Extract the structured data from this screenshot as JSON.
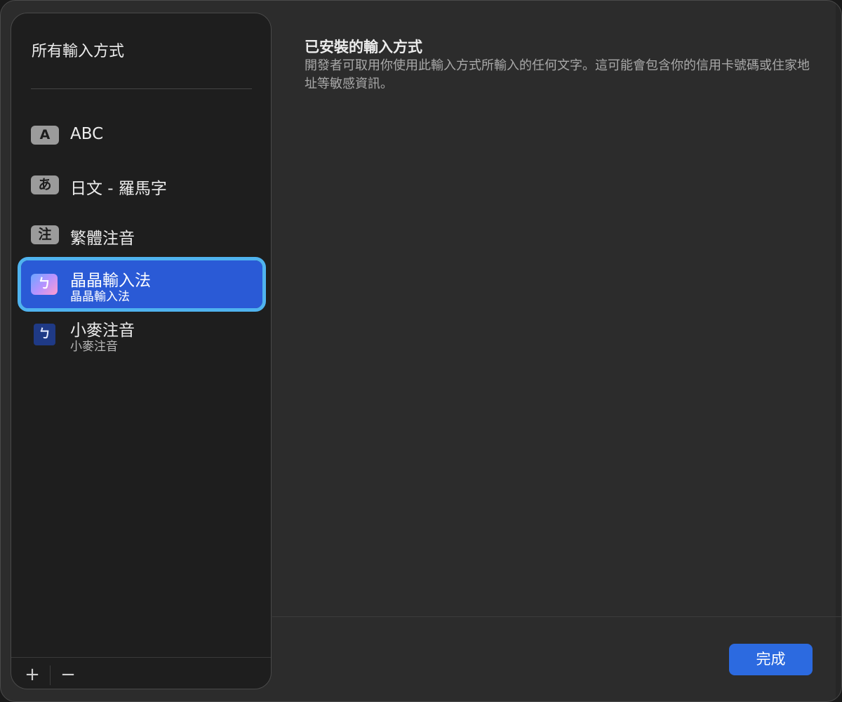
{
  "sidebar": {
    "title": "所有輸入方式",
    "items": [
      {
        "badge": "A",
        "label": "ABC",
        "sublabel": ""
      },
      {
        "badge": "あ",
        "label": "日文 - 羅馬字",
        "sublabel": ""
      },
      {
        "badge": "注",
        "label": "繁體注音",
        "sublabel": ""
      },
      {
        "badge": "ㄅ",
        "label": "晶晶輸入法",
        "sublabel": "晶晶輸入法",
        "selected": true
      },
      {
        "badge": "ㄅ",
        "label": "小麥注音",
        "sublabel": "小麥注音"
      }
    ],
    "add_label": "+",
    "remove_label": "−"
  },
  "main": {
    "title": "已安裝的輸入方式",
    "description": "開發者可取用你使用此輸入方式所輸入的任何文字。這可能會包含你的信用卡號碼或住家地址等敏感資訊。"
  },
  "footer": {
    "done_label": "完成"
  },
  "colors": {
    "accent": "#2c6ae0",
    "selection": "#2a5ad6",
    "focus_ring": "#4fb3ef"
  }
}
